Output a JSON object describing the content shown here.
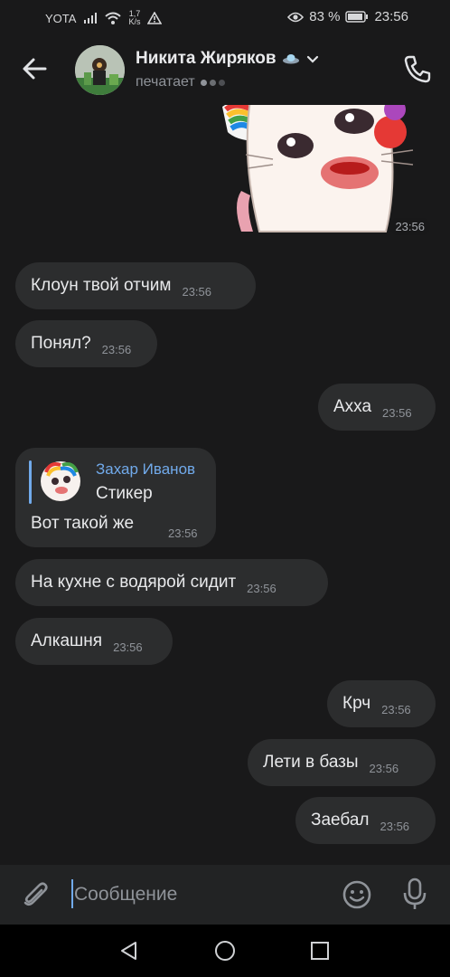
{
  "status_bar": {
    "carrier": "YOTA",
    "net_speed_value": "1,7",
    "net_speed_unit": "K/s",
    "battery_percent": "83 %",
    "clock": "23:56"
  },
  "header": {
    "contact_name": "Никита Жиряков",
    "status": "печатает"
  },
  "messages": {
    "sticker_time": "23:56",
    "m1_text": "Клоун твой отчим",
    "m1_time": "23:56",
    "m2_text": "Понял?",
    "m2_time": "23:56",
    "m3_text": "Ахха",
    "m3_time": "23:56",
    "m4_reply_author": "Захар Иванов",
    "m4_reply_text": "Стикер",
    "m4_text": "Вот такой же",
    "m4_time": "23:56",
    "m5_text": "На кухне с водярой сидит",
    "m5_time": "23:56",
    "m6_text": "Алкашня",
    "m6_time": "23:56",
    "m7_text": "Крч",
    "m7_time": "23:56",
    "m8_text": "Лети в базы",
    "m8_time": "23:56",
    "m9_text": "Заебал",
    "m9_time": "23:56"
  },
  "composer": {
    "placeholder": "Сообщение"
  },
  "icons": {
    "back": "arrow-left-icon",
    "call": "phone-icon",
    "attach": "paperclip-icon",
    "emoji": "smiley-icon",
    "mic": "microphone-icon"
  },
  "colors": {
    "background": "#19191a",
    "bubble": "#2c2d2e",
    "accent": "#71aaeb",
    "text": "#e8e9eb",
    "muted": "#8f9399"
  }
}
